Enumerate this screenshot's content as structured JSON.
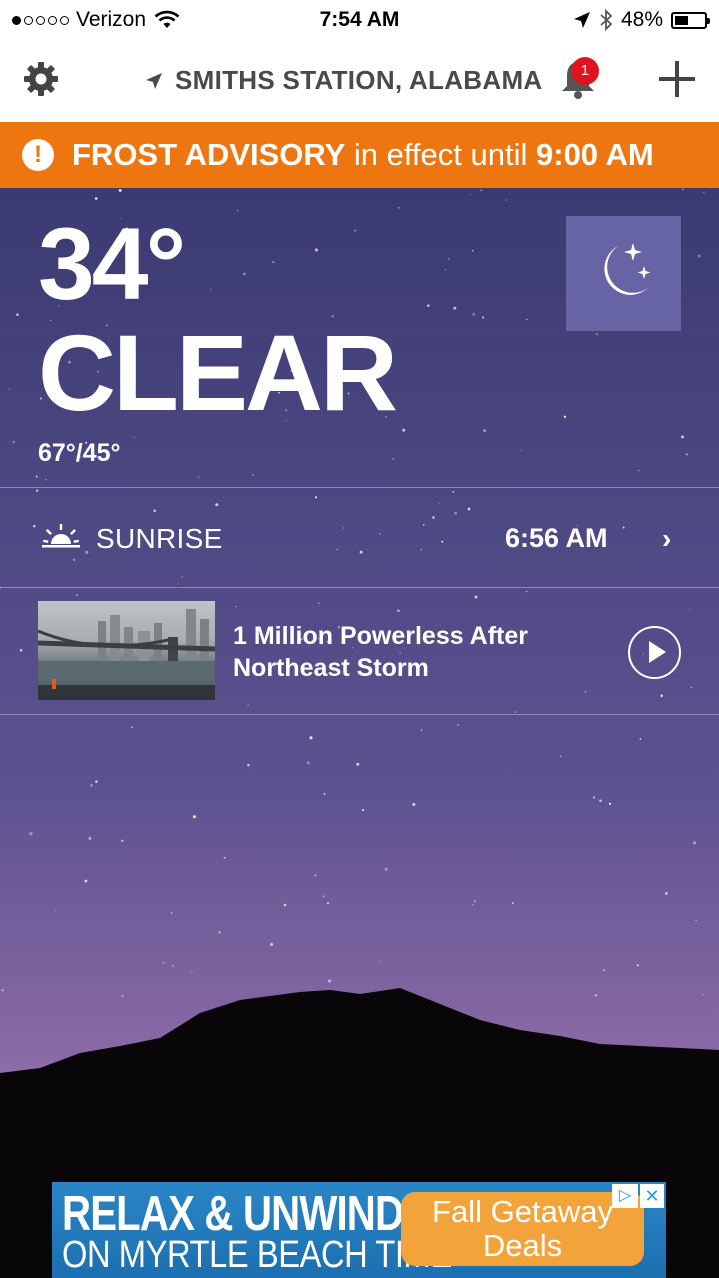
{
  "status_bar": {
    "carrier": "Verizon",
    "time": "7:54 AM",
    "battery_percent": "48%",
    "battery_level": 0.48,
    "signal_bars_filled": 1
  },
  "header": {
    "settings_icon": "gear-icon",
    "location_icon": "location-arrow-icon",
    "location": "SMITHS STATION, ALABAMA",
    "notification_icon": "bell-icon",
    "notification_count": "1",
    "add_icon": "plus-icon"
  },
  "advisory": {
    "icon": "alert-icon",
    "title": "FROST ADVISORY",
    "middle": " in effect until ",
    "until": "9:00 AM",
    "color": "#ee7611"
  },
  "current": {
    "temperature": "34°",
    "condition": "CLEAR",
    "hi_lo": "67°/45°",
    "condition_icon": "moon-stars-icon"
  },
  "sunrise": {
    "icon": "sunrise-icon",
    "label": "SUNRISE",
    "time": "6:56 AM"
  },
  "news": {
    "title": "1 Million Powerless After Northeast Storm",
    "play_icon": "play-icon"
  },
  "ad": {
    "line1": "RELAX & UNWIND",
    "line2": "ON MYRTLE BEACH TIME",
    "cta_line1": "Fall Getaway",
    "cta_line2": "Deals"
  }
}
